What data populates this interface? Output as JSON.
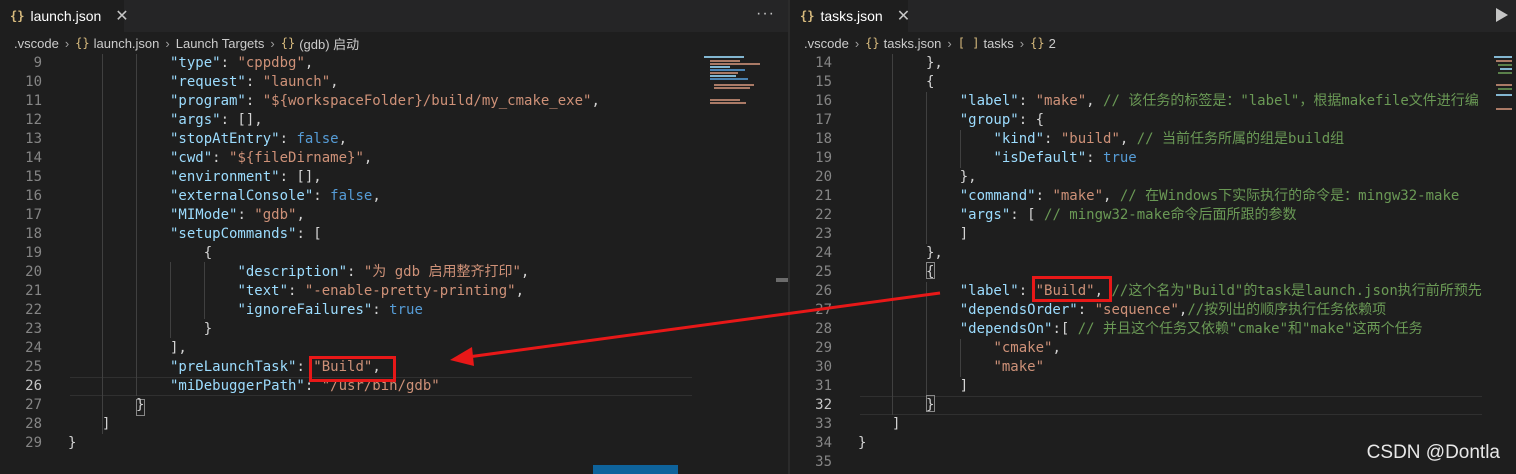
{
  "left_editor": {
    "tab": {
      "icon": "json-braces-icon",
      "label": "launch.json",
      "close": "✕"
    },
    "more_actions": "···",
    "breadcrumb": [
      {
        "label": ".vscode",
        "icon": ""
      },
      {
        "label": "launch.json",
        "icon": "{}"
      },
      {
        "label": "Launch Targets",
        "icon": ""
      },
      {
        "label": "(gdb) 启动",
        "icon": "{}"
      }
    ],
    "current_line": 26,
    "lines": [
      {
        "n": "9",
        "t": [
          [
            "k",
            "\"type\""
          ],
          [
            "p",
            ": "
          ],
          [
            "s",
            "\"cppdbg\""
          ],
          [
            "p",
            ","
          ]
        ]
      },
      {
        "n": "10",
        "t": [
          [
            "k",
            "\"request\""
          ],
          [
            "p",
            ": "
          ],
          [
            "s",
            "\"launch\""
          ],
          [
            "p",
            ","
          ]
        ]
      },
      {
        "n": "11",
        "t": [
          [
            "k",
            "\"program\""
          ],
          [
            "p",
            ": "
          ],
          [
            "s",
            "\"${workspaceFolder}/build/my_cmake_exe\""
          ],
          [
            "p",
            ","
          ]
        ]
      },
      {
        "n": "12",
        "t": [
          [
            "k",
            "\"args\""
          ],
          [
            "p",
            ": [],"
          ]
        ]
      },
      {
        "n": "13",
        "t": [
          [
            "k",
            "\"stopAtEntry\""
          ],
          [
            "p",
            ": "
          ],
          [
            "b",
            "false"
          ],
          [
            "p",
            ","
          ]
        ]
      },
      {
        "n": "14",
        "t": [
          [
            "k",
            "\"cwd\""
          ],
          [
            "p",
            ": "
          ],
          [
            "s",
            "\"${fileDirname}\""
          ],
          [
            "p",
            ","
          ]
        ]
      },
      {
        "n": "15",
        "t": [
          [
            "k",
            "\"environment\""
          ],
          [
            "p",
            ": [],"
          ]
        ]
      },
      {
        "n": "16",
        "t": [
          [
            "k",
            "\"externalConsole\""
          ],
          [
            "p",
            ": "
          ],
          [
            "b",
            "false"
          ],
          [
            "p",
            ","
          ]
        ]
      },
      {
        "n": "17",
        "t": [
          [
            "k",
            "\"MIMode\""
          ],
          [
            "p",
            ": "
          ],
          [
            "s",
            "\"gdb\""
          ],
          [
            "p",
            ","
          ]
        ]
      },
      {
        "n": "18",
        "t": [
          [
            "k",
            "\"setupCommands\""
          ],
          [
            "p",
            ": ["
          ]
        ]
      },
      {
        "n": "19",
        "t": [
          [
            "p",
            "    {"
          ]
        ]
      },
      {
        "n": "20",
        "t": [
          [
            "p",
            "        "
          ],
          [
            "k",
            "\"description\""
          ],
          [
            "p",
            ": "
          ],
          [
            "s",
            "\"为 gdb 启用整齐打印\""
          ],
          [
            "p",
            ","
          ]
        ]
      },
      {
        "n": "21",
        "t": [
          [
            "p",
            "        "
          ],
          [
            "k",
            "\"text\""
          ],
          [
            "p",
            ": "
          ],
          [
            "s",
            "\"-enable-pretty-printing\""
          ],
          [
            "p",
            ","
          ]
        ]
      },
      {
        "n": "22",
        "t": [
          [
            "p",
            "        "
          ],
          [
            "k",
            "\"ignoreFailures\""
          ],
          [
            "p",
            ": "
          ],
          [
            "b",
            "true"
          ]
        ]
      },
      {
        "n": "23",
        "t": [
          [
            "p",
            "    }"
          ]
        ]
      },
      {
        "n": "24",
        "t": [
          [
            "p",
            "],"
          ]
        ]
      },
      {
        "n": "25",
        "t": [
          [
            "k",
            "\"preLaunchTask\""
          ],
          [
            "p",
            ": "
          ],
          [
            "s",
            "\"Build\""
          ],
          [
            "p",
            ","
          ]
        ]
      },
      {
        "n": "26",
        "t": [
          [
            "k",
            "\"miDebuggerPath\""
          ],
          [
            "p",
            ": "
          ],
          [
            "s",
            "\"/usr/bin/gdb\""
          ]
        ]
      },
      {
        "n": "27",
        "t": [
          [
            "p",
            "}"
          ]
        ]
      },
      {
        "n": "28",
        "t": [
          [
            "p",
            "]"
          ]
        ]
      },
      {
        "n": "29",
        "t": [
          [
            "p",
            "}"
          ]
        ]
      }
    ]
  },
  "right_editor": {
    "tab": {
      "icon": "json-braces-icon",
      "label": "tasks.json",
      "close": "✕"
    },
    "run_button": "run-icon",
    "breadcrumb": [
      {
        "label": ".vscode",
        "icon": ""
      },
      {
        "label": "tasks.json",
        "icon": "{}"
      },
      {
        "label": "tasks",
        "icon": "[ ]"
      },
      {
        "label": "2",
        "icon": "{}"
      }
    ],
    "current_line": 32,
    "lines": [
      {
        "n": "14",
        "t": [
          [
            "p",
            "},"
          ]
        ]
      },
      {
        "n": "15",
        "t": [
          [
            "p",
            "{"
          ]
        ]
      },
      {
        "n": "16",
        "t": [
          [
            "p",
            "    "
          ],
          [
            "k",
            "\"label\""
          ],
          [
            "p",
            ": "
          ],
          [
            "s",
            "\"make\""
          ],
          [
            "p",
            ", "
          ],
          [
            "c",
            "// 该任务的标签是：\"label\"，根据makefile文件进行编"
          ]
        ]
      },
      {
        "n": "17",
        "t": [
          [
            "p",
            "    "
          ],
          [
            "k",
            "\"group\""
          ],
          [
            "p",
            ": {"
          ]
        ]
      },
      {
        "n": "18",
        "t": [
          [
            "p",
            "        "
          ],
          [
            "k",
            "\"kind\""
          ],
          [
            "p",
            ": "
          ],
          [
            "s",
            "\"build\""
          ],
          [
            "p",
            ", "
          ],
          [
            "c",
            "// 当前任务所属的组是build组"
          ]
        ]
      },
      {
        "n": "19",
        "t": [
          [
            "p",
            "        "
          ],
          [
            "k",
            "\"isDefault\""
          ],
          [
            "p",
            ": "
          ],
          [
            "b",
            "true"
          ]
        ]
      },
      {
        "n": "20",
        "t": [
          [
            "p",
            "    },"
          ]
        ]
      },
      {
        "n": "21",
        "t": [
          [
            "p",
            "    "
          ],
          [
            "k",
            "\"command\""
          ],
          [
            "p",
            ": "
          ],
          [
            "s",
            "\"make\""
          ],
          [
            "p",
            ", "
          ],
          [
            "c",
            "// 在Windows下实际执行的命令是：mingw32-make"
          ]
        ]
      },
      {
        "n": "22",
        "t": [
          [
            "p",
            "    "
          ],
          [
            "k",
            "\"args\""
          ],
          [
            "p",
            ": [ "
          ],
          [
            "c",
            "// mingw32-make命令后面所跟的参数"
          ]
        ]
      },
      {
        "n": "23",
        "t": [
          [
            "p",
            "    ]"
          ]
        ]
      },
      {
        "n": "24",
        "t": [
          [
            "p",
            "},"
          ]
        ]
      },
      {
        "n": "25",
        "t": [
          [
            "p",
            "{"
          ]
        ]
      },
      {
        "n": "26",
        "t": [
          [
            "p",
            "    "
          ],
          [
            "k",
            "\"label\""
          ],
          [
            "p",
            ": "
          ],
          [
            "s",
            "\"Build\""
          ],
          [
            "p",
            ", "
          ],
          [
            "c",
            "//这个名为\"Build\"的task是launch.json执行前所预先"
          ]
        ]
      },
      {
        "n": "27",
        "t": [
          [
            "p",
            "    "
          ],
          [
            "k",
            "\"dependsOrder\""
          ],
          [
            "p",
            ": "
          ],
          [
            "s",
            "\"sequence\""
          ],
          [
            "p",
            ","
          ],
          [
            "c",
            "//按列出的顺序执行任务依赖项"
          ]
        ]
      },
      {
        "n": "28",
        "t": [
          [
            "p",
            "    "
          ],
          [
            "k",
            "\"dependsOn\""
          ],
          [
            "p",
            ":[ "
          ],
          [
            "c",
            "// 并且这个任务又依赖\"cmake\"和\"make\"这两个任务"
          ]
        ]
      },
      {
        "n": "29",
        "t": [
          [
            "p",
            "        "
          ],
          [
            "s",
            "\"cmake\""
          ],
          [
            "p",
            ","
          ]
        ]
      },
      {
        "n": "30",
        "t": [
          [
            "p",
            "        "
          ],
          [
            "s",
            "\"make\""
          ]
        ]
      },
      {
        "n": "31",
        "t": [
          [
            "p",
            "    ]"
          ]
        ]
      },
      {
        "n": "32",
        "t": [
          [
            "p",
            "}"
          ]
        ]
      },
      {
        "n": "33",
        "t": [
          [
            "p",
            "]"
          ]
        ]
      },
      {
        "n": "34",
        "t": [
          [
            "p",
            "}"
          ]
        ]
      },
      {
        "n": "35",
        "t": []
      }
    ]
  },
  "annotations": {
    "left_highlight_text": "\"Build\"",
    "right_highlight_text": "\"Build\"",
    "box_color": "#e81818",
    "arrow_color": "#e81818"
  },
  "watermark": "CSDN @Dontla",
  "colors": {
    "key": "#9cdcfe",
    "string": "#ce9178",
    "keyword": "#569cd6",
    "comment": "#6a9955",
    "punct": "#d4d4d4",
    "background": "#1e1e1e"
  }
}
